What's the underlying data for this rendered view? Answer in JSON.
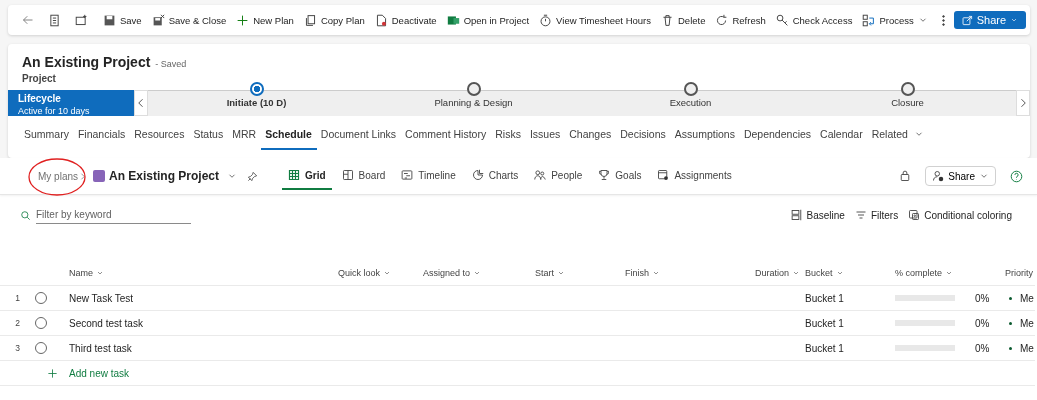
{
  "command_bar": {
    "items": [
      {
        "label": "Save"
      },
      {
        "label": "Save & Close"
      },
      {
        "label": "New Plan"
      },
      {
        "label": "Copy Plan"
      },
      {
        "label": "Deactivate"
      },
      {
        "label": "Open in Project"
      },
      {
        "label": "View Timesheet Hours"
      },
      {
        "label": "Delete"
      },
      {
        "label": "Refresh"
      },
      {
        "label": "Check Access"
      },
      {
        "label": "Process"
      }
    ],
    "share": "Share"
  },
  "record": {
    "title": "An Existing Project",
    "status": "- Saved",
    "type": "Project"
  },
  "lifecycle": {
    "name": "Lifecycle",
    "duration": "Active for 10 days",
    "stages": [
      {
        "label": "Initiate  (10 D)",
        "selected": true
      },
      {
        "label": "Planning & Design",
        "selected": false
      },
      {
        "label": "Execution",
        "selected": false
      },
      {
        "label": "Closure",
        "selected": false
      }
    ]
  },
  "tabs": [
    {
      "label": "Summary",
      "selected": false
    },
    {
      "label": "Financials",
      "selected": false
    },
    {
      "label": "Resources",
      "selected": false
    },
    {
      "label": "Status",
      "selected": false
    },
    {
      "label": "MRR",
      "selected": false
    },
    {
      "label": "Schedule",
      "selected": true
    },
    {
      "label": "Document Links",
      "selected": false
    },
    {
      "label": "Comment History",
      "selected": false
    },
    {
      "label": "Risks",
      "selected": false
    },
    {
      "label": "Issues",
      "selected": false
    },
    {
      "label": "Changes",
      "selected": false
    },
    {
      "label": "Decisions",
      "selected": false
    },
    {
      "label": "Assumptions",
      "selected": false
    },
    {
      "label": "Dependencies",
      "selected": false
    },
    {
      "label": "Calendar",
      "selected": false
    },
    {
      "label": "Related",
      "selected": false
    }
  ],
  "plan": {
    "breadcrumb": "My plans",
    "name": "An Existing Project",
    "views": [
      {
        "label": "Grid",
        "selected": true
      },
      {
        "label": "Board",
        "selected": false
      },
      {
        "label": "Timeline",
        "selected": false
      },
      {
        "label": "Charts",
        "selected": false
      },
      {
        "label": "People",
        "selected": false
      },
      {
        "label": "Goals",
        "selected": false
      },
      {
        "label": "Assignments",
        "selected": false
      }
    ],
    "share": "Share"
  },
  "toolbar": {
    "filter_placeholder": "Filter by keyword",
    "actions": [
      "Baseline",
      "Filters",
      "Conditional coloring"
    ]
  },
  "table": {
    "columns": [
      "Name",
      "Quick look",
      "Assigned to",
      "Start",
      "Finish",
      "Duration",
      "Bucket",
      "% complete",
      "Priority"
    ],
    "rows": [
      {
        "number": "1",
        "name": "New Task Test",
        "completed": false,
        "bucket": "Bucket 1",
        "level": 0,
        "percent": "0%",
        "priority": "Me"
      },
      {
        "number": "2",
        "name": "Second test task",
        "completed": false,
        "bucket": "Bucket 1",
        "level": 0,
        "percent": "0%",
        "priority": "Me"
      },
      {
        "number": "3",
        "name": "Third test task",
        "completed": false,
        "bucket": "Bucket 1",
        "level": 0,
        "percent": "0%",
        "priority": "Me"
      }
    ],
    "add_label": "Add new task"
  }
}
